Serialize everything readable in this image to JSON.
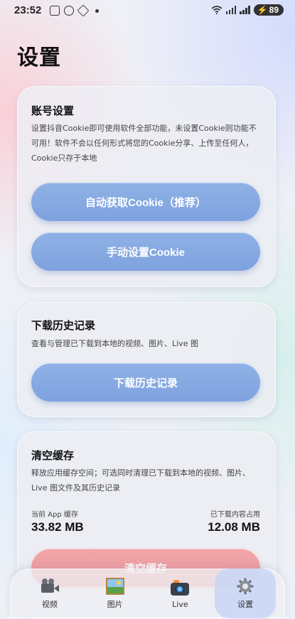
{
  "status_bar": {
    "time": "23:52",
    "battery": "89"
  },
  "page": {
    "title": "设置"
  },
  "account": {
    "title": "账号设置",
    "desc": "设置抖音Cookie即可使用软件全部功能，未设置Cookie则功能不可用！软件不会以任何形式将您的Cookie分享、上传至任何人，Cookie只存于本地",
    "auto_btn": "自动获取Cookie（推荐）",
    "manual_btn": "手动设置Cookie"
  },
  "history": {
    "title": "下载历史记录",
    "desc": "查看与管理已下载到本地的视频、图片、Live 图",
    "btn": "下载历史记录"
  },
  "cache": {
    "title": "清空缓存",
    "desc": "释放应用缓存空间；可选同时清理已下载到本地的视频、图片、Live 图文件及其历史记录",
    "app_cache_label": "当前 App 缓存",
    "app_cache_value": "33.82 MB",
    "downloaded_label": "已下载内容占用",
    "downloaded_value": "12.08 MB",
    "clear_btn": "清空缓存"
  },
  "nav": {
    "items": [
      {
        "label": "视频",
        "icon": "video-camera-icon"
      },
      {
        "label": "图片",
        "icon": "picture-icon"
      },
      {
        "label": "Live",
        "icon": "live-camera-icon"
      },
      {
        "label": "设置",
        "icon": "gear-icon"
      }
    ],
    "active_index": 3
  },
  "colors": {
    "primary_button": "#7ea2df",
    "danger_button": "#ec9599",
    "active_tab": "#c8d6f5"
  }
}
